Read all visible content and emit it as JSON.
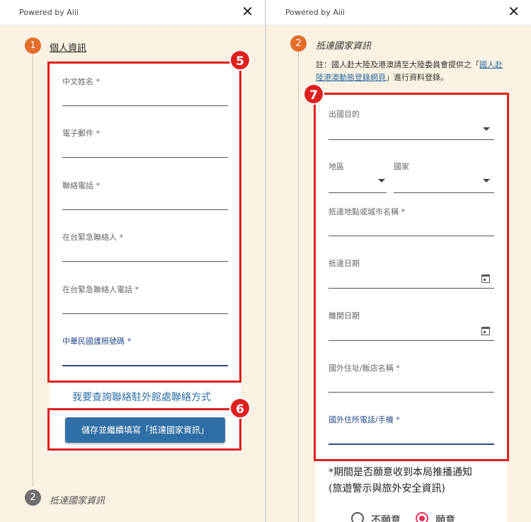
{
  "header": {
    "powered_by": "Powered by Aiii",
    "close": "✕"
  },
  "left": {
    "step1": {
      "number": "1",
      "title": "個人資訊"
    },
    "fields": [
      {
        "label": "中文姓名 *"
      },
      {
        "label": "電子郵件 *"
      },
      {
        "label": "聯絡電話 *"
      },
      {
        "label": "在台緊急聯絡人 *"
      },
      {
        "label": "在台緊急聯絡人電話 *"
      },
      {
        "label": "中華民國護照號碼 *"
      }
    ],
    "query_link": "我要查詢聯絡駐外館處聯絡方式",
    "save_button": "儲存並繼續填寫「抵達國家資訊」",
    "step2": {
      "number": "2",
      "title": "抵達國家資訊"
    },
    "badge5": "5",
    "badge6": "6"
  },
  "right": {
    "step2": {
      "number": "2",
      "title": "抵達國家資訊"
    },
    "note_prefix": "註：國人赴大陸及港澳請至大陸委員會提供之「",
    "note_link": "國人赴陸港澳動態登錄網頁",
    "note_suffix": "」進行資料登錄。",
    "badge7": "7",
    "fields": {
      "purpose": "出國目的",
      "region": "地區",
      "country": "國家",
      "city": "抵達地點或城市名稱 *",
      "arrive_date": "抵達日期",
      "leave_date": "離開日期",
      "address": "國外住址/飯店名稱 *",
      "phone": "國外住所電話/手機 *"
    },
    "notice_line1": "*期間是否願意收到本局推播通知",
    "notice_line2": "(旅遊警示與旅外安全資訊)",
    "radio_no": "不願意",
    "radio_yes": "願意"
  },
  "colors": {
    "accent": "#e46d2b",
    "primary": "#2f6fa5",
    "highlight": "#e01f1f",
    "radio": "#e0325a"
  }
}
